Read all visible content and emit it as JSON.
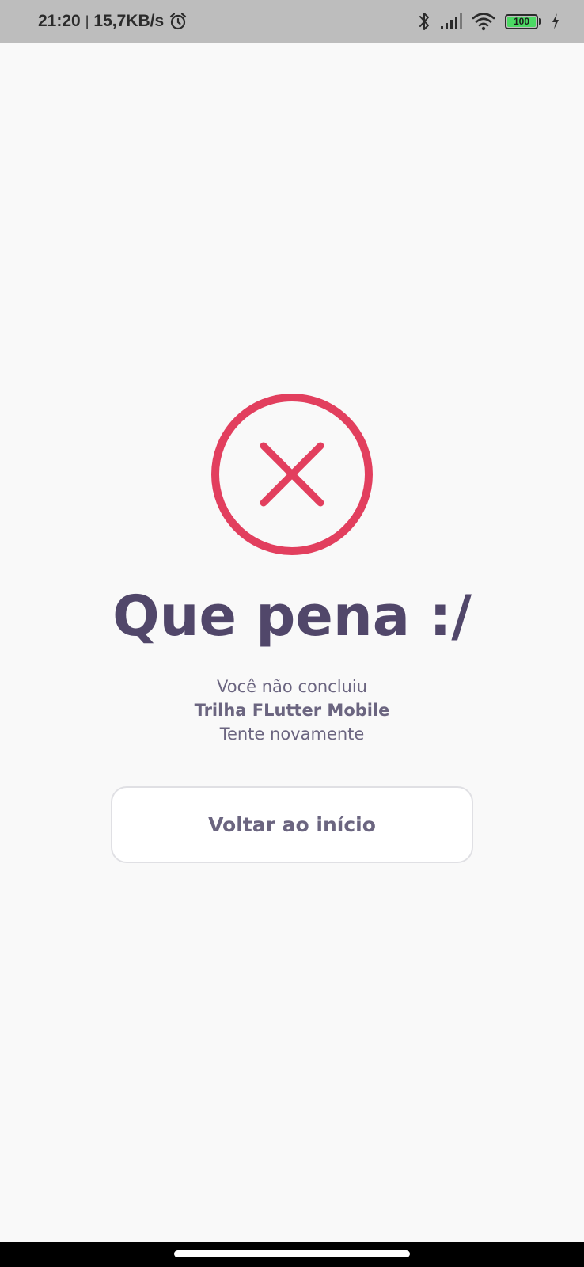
{
  "status_bar": {
    "time": "21:20",
    "separator": "|",
    "network_speed": "15,7KB/s",
    "battery_level": "100",
    "icons": [
      "alarm-icon",
      "bluetooth-icon",
      "signal-icon",
      "wifi-icon",
      "battery-icon",
      "charging-icon"
    ]
  },
  "result": {
    "icon": "error-circle-x-icon",
    "accent_color": "#e23f5e",
    "title": "Que pena :/",
    "line1": "Você não concluiu",
    "track_name": "Trilha FLutter Mobile",
    "line3": "Tente novamente",
    "title_color": "#51476a",
    "text_color": "#6b6580"
  },
  "actions": {
    "back_label": "Voltar ao início"
  }
}
